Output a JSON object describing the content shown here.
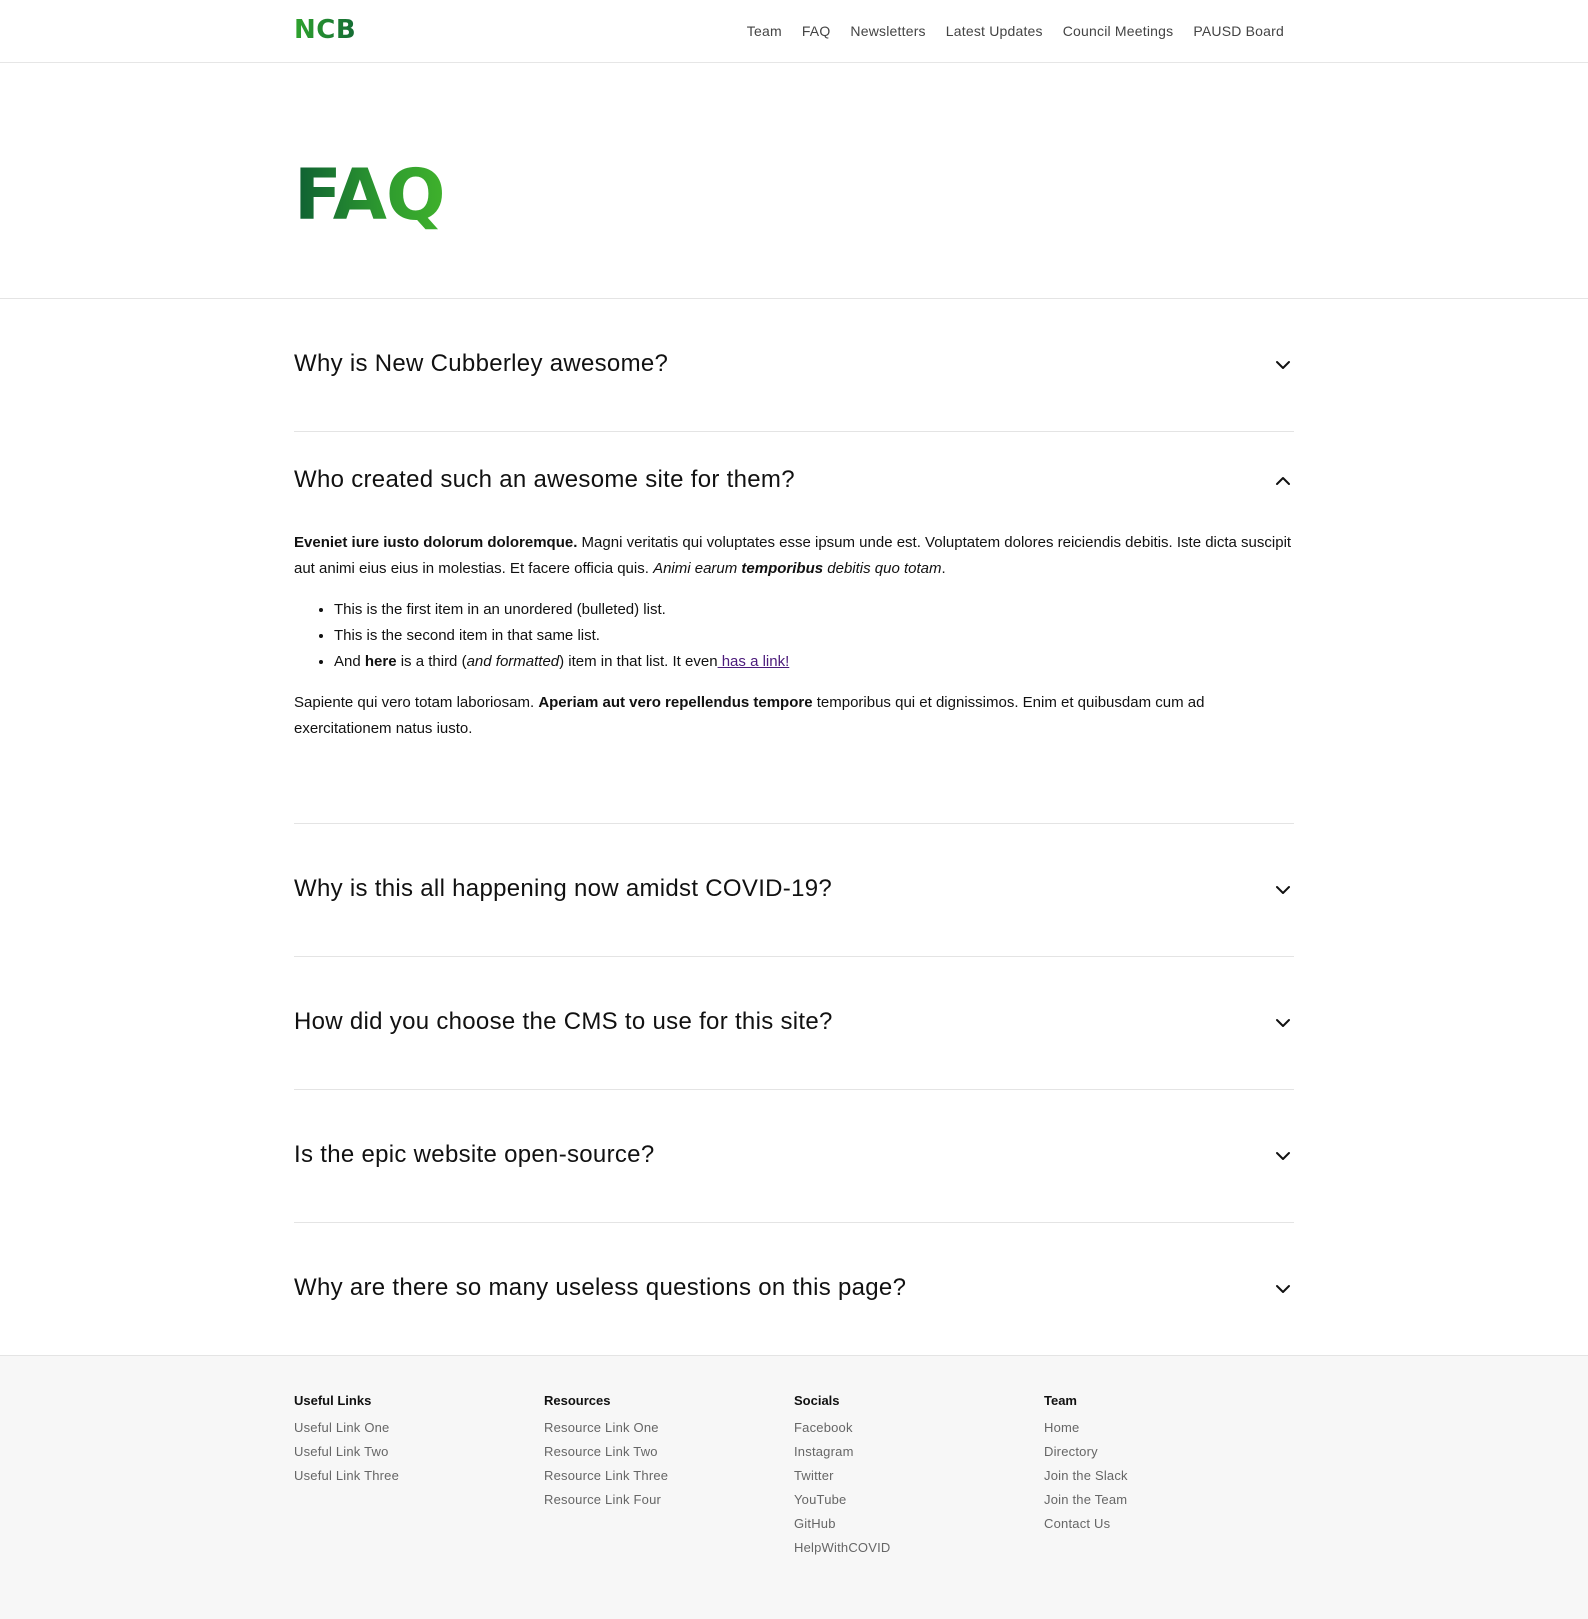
{
  "header": {
    "logo": "NCB",
    "nav": [
      "Team",
      "FAQ",
      "Newsletters",
      "Latest Updates",
      "Council Meetings",
      "PAUSD Board"
    ]
  },
  "hero": {
    "title": "FAQ"
  },
  "faq": [
    {
      "question": "Why is New Cubberley awesome?",
      "expanded": false
    },
    {
      "question": "Who created such an awesome site for them?",
      "expanded": true,
      "answer": {
        "p1_bold": "Eveniet iure iusto dolorum doloremque.",
        "p1_text": " Magni veritatis qui voluptates esse ipsum unde est. Voluptatem dolores reiciendis debitis. Iste dicta suscipit aut animi eius eius in molestias. Et facere officia quis. ",
        "p1_italic_a": "Animi earum ",
        "p1_italic_bold": "temporibus",
        "p1_italic_b": " debitis quo totam",
        "p1_end": ".",
        "list": [
          "This is the first item in an unordered (bulleted) list.",
          "This is the second item in that same list."
        ],
        "li3_a": "And ",
        "li3_bold": "here",
        "li3_b": " is a third (",
        "li3_italic": "and formatted",
        "li3_c": ") item in that list. It even",
        "li3_link": " has a link!",
        "p2_a": "Sapiente qui vero totam laboriosam. ",
        "p2_bold": "Aperiam aut vero repellendus tempore",
        "p2_b": " temporibus qui et dignissimos. Enim et quibusdam cum ad exercitationem natus iusto."
      }
    },
    {
      "question": "Why is this all happening now amidst COVID-19?",
      "expanded": false
    },
    {
      "question": "How did you choose the CMS to use for this site?",
      "expanded": false
    },
    {
      "question": "Is the epic website open-source?",
      "expanded": false
    },
    {
      "question": "Why are there so many useless questions on this page?",
      "expanded": false
    }
  ],
  "footer": {
    "columns": [
      {
        "heading": "Useful Links",
        "links": [
          "Useful Link One",
          "Useful Link Two",
          "Useful Link Three"
        ]
      },
      {
        "heading": "Resources",
        "links": [
          "Resource Link One",
          "Resource Link Two",
          "Resource Link Three",
          "Resource Link Four"
        ]
      },
      {
        "heading": "Socials",
        "links": [
          "Facebook",
          "Instagram",
          "Twitter",
          "YouTube",
          "GitHub",
          "HelpWithCOVID"
        ]
      },
      {
        "heading": "Team",
        "links": [
          "Home",
          "Directory",
          "Join the Slack",
          "Join the Team",
          "Contact Us"
        ]
      }
    ]
  },
  "colors": {
    "brand_green": "#2fa32e",
    "brand_green_dark": "#146b34",
    "link_purple": "#4b1a7a",
    "footer_bg": "#f7f7f7"
  },
  "icons": {
    "collapsed": "chevron-down-icon",
    "expanded": "chevron-up-icon"
  }
}
